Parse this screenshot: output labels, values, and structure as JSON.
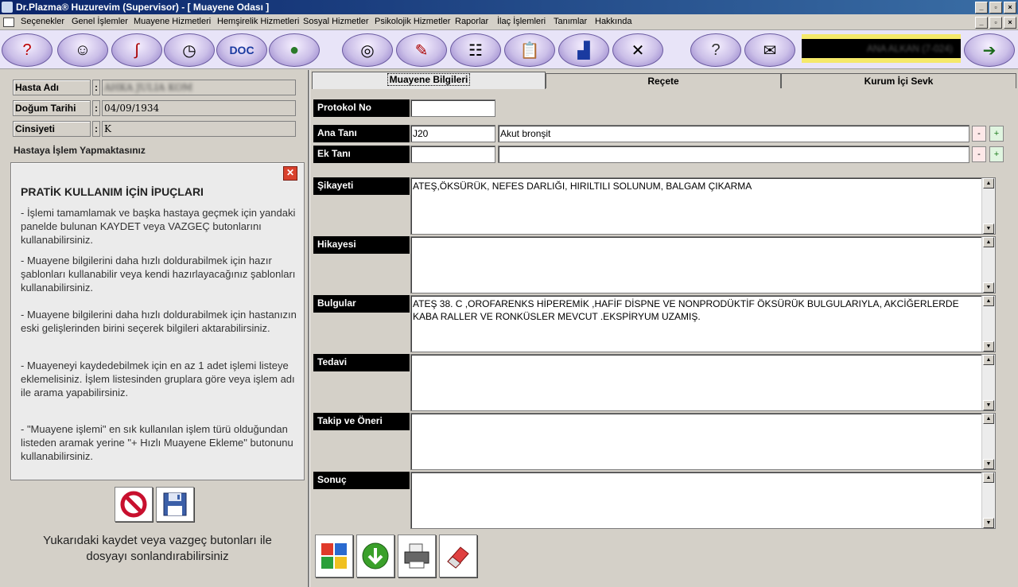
{
  "window": {
    "title": "Dr.Plazma® Huzurevim (Supervisor) - [ Muayene Odası ]"
  },
  "menu": [
    "Seçenekler",
    "Genel İşlemler",
    "Muayene Hizmetleri",
    "Hemşirelik Hizmetleri",
    "Sosyal Hizmetler",
    "Psikolojik Hizmetler",
    "Raporlar",
    "İlaç İşlemleri",
    "Tanımlar",
    "Hakkında"
  ],
  "toolbar": {
    "user_name": "ANA ALKAN (7-024)"
  },
  "patient": {
    "name_label": "Hasta Adı",
    "name_value": "AHKA JULIA KOM",
    "dob_label": "Doğum Tarihi",
    "dob_value": "04/09/1934",
    "gender_label": "Cinsiyeti",
    "gender_value": "K",
    "colon": ":"
  },
  "notice": "Hastaya İşlem Yapmaktasınız",
  "tips": {
    "title": "PRATİK KULLANIM İÇİN İPUÇLARI",
    "items": [
      "- İşlemi tamamlamak ve başka hastaya geçmek için yandaki panelde bulunan KAYDET veya VAZGEÇ butonlarını kullanabilirsiniz.",
      "- Muayene bilgilerini daha hızlı doldurabilmek için hazır şablonları kullanabilir veya kendi hazırlayacağınız şablonları kullanabilirsiniz.",
      "- Muayene bilgilerini daha hızlı doldurabilmek için hastanızın eski gelişlerinden birini seçerek bilgileri aktarabilirsiniz.",
      "- Muayeneyi kaydedebilmek için en az 1 adet işlemi listeye eklemelisiniz. İşlem listesinden gruplara göre veya işlem adı ile arama yapabilirsiniz.",
      "- \"Muayene işlemi\" en sık kullanılan işlem türü olduğundan listeden aramak yerine \"+ Hızlı Muayene Ekleme\" butonunu kullanabilirsiniz."
    ]
  },
  "footer_note": "Yukarıdaki kaydet veya vazgeç butonları ile dosyayı sonlandırabilirsiniz",
  "tabs": [
    "Muayene Bilgileri",
    "Reçete",
    "Kurum İçi Sevk"
  ],
  "form": {
    "protokol_label": "Protokol No",
    "protokol_value": "",
    "ana_tani_label": "Ana Tanı",
    "ana_tani_code": "J20",
    "ana_tani_desc": "Akut bronşit",
    "ek_tani_label": "Ek Tanı",
    "ek_tani_code": "",
    "ek_tani_desc": "",
    "minus": "-",
    "plus": "+",
    "sikayeti_label": "Şikayeti",
    "sikayeti_value": "ATEŞ,ÖKSÜRÜK, NEFES DARLIĞI, HIRILTILI SOLUNUM, BALGAM ÇIKARMA",
    "hikayesi_label": "Hikayesi",
    "hikayesi_value": "",
    "bulgular_label": "Bulgular",
    "bulgular_value": "ATEŞ 38. C ,OROFARENKS HİPEREMİK ,HAFİF DİSPNE VE NONPRODÜKTİF ÖKSÜRÜK BULGULARIYLA, AKCİĞERLERDE KABA RALLER VE  RONKÜSLER  MEVCUT .EKSPİRYUM UZAMIŞ.",
    "tedavi_label": "Tedavi",
    "tedavi_value": "",
    "takip_label": "Takip ve Öneri",
    "takip_value": "",
    "sonuc_label": "Sonuç",
    "sonuc_value": ""
  }
}
